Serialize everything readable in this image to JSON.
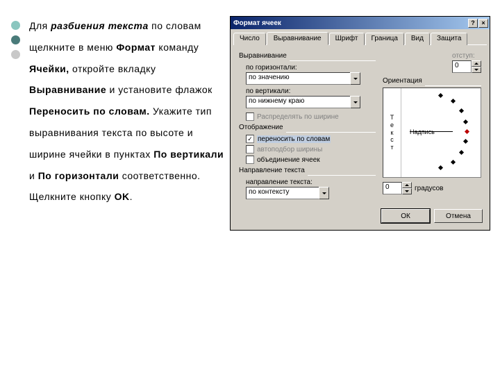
{
  "sidebar_text": {
    "p1a": "Для ",
    "p1b": "разбиения текста",
    "p1c": " по словам щелкните в меню ",
    "p1d": "Формат",
    "p1e": " команду ",
    "p1f": "Ячейки,",
    "p1g": " откройте вкладку ",
    "p1h": "Выравнивание",
    "p1i": " и установите флажок ",
    "p1j": "Переносить по словам.",
    "p1k": " Укажите тип выравнивания текста по высоте и ширине ячейки в пунктах ",
    "p1l": "По вертикали",
    "p1m": " и ",
    "p1n": "По горизонтали",
    "p1o": " соответственно.  Щелкните кнопку ",
    "p1p": "OK",
    "p1q": "."
  },
  "dialog": {
    "title": "Формат ячеек",
    "tabs": [
      "Число",
      "Выравнивание",
      "Шрифт",
      "Граница",
      "Вид",
      "Защита"
    ],
    "active_tab": 1,
    "groups": {
      "alignment": "Выравнивание",
      "horizontal": "по горизонтали:",
      "horizontal_value": "по значению",
      "indent": "отступ:",
      "indent_value": "0",
      "vertical": "по вертикали:",
      "vertical_value": "по нижнему краю",
      "justify_distributed": "Распределять по ширине",
      "display": "Отображение",
      "wrap_text": "переносить по словам",
      "shrink": "автоподбор ширины",
      "merge": "объединение ячеек",
      "text_direction": "Направление текста",
      "text_dir_label": "направление текста:",
      "text_dir_value": "по контексту",
      "orientation": "Ориентация",
      "orient_vert": "Текст",
      "orient_label": "Надпись",
      "degrees_value": "0",
      "degrees_label": "градусов"
    },
    "buttons": {
      "ok": "ОК",
      "cancel": "Отмена"
    },
    "title_help": "?",
    "title_close": "×"
  }
}
